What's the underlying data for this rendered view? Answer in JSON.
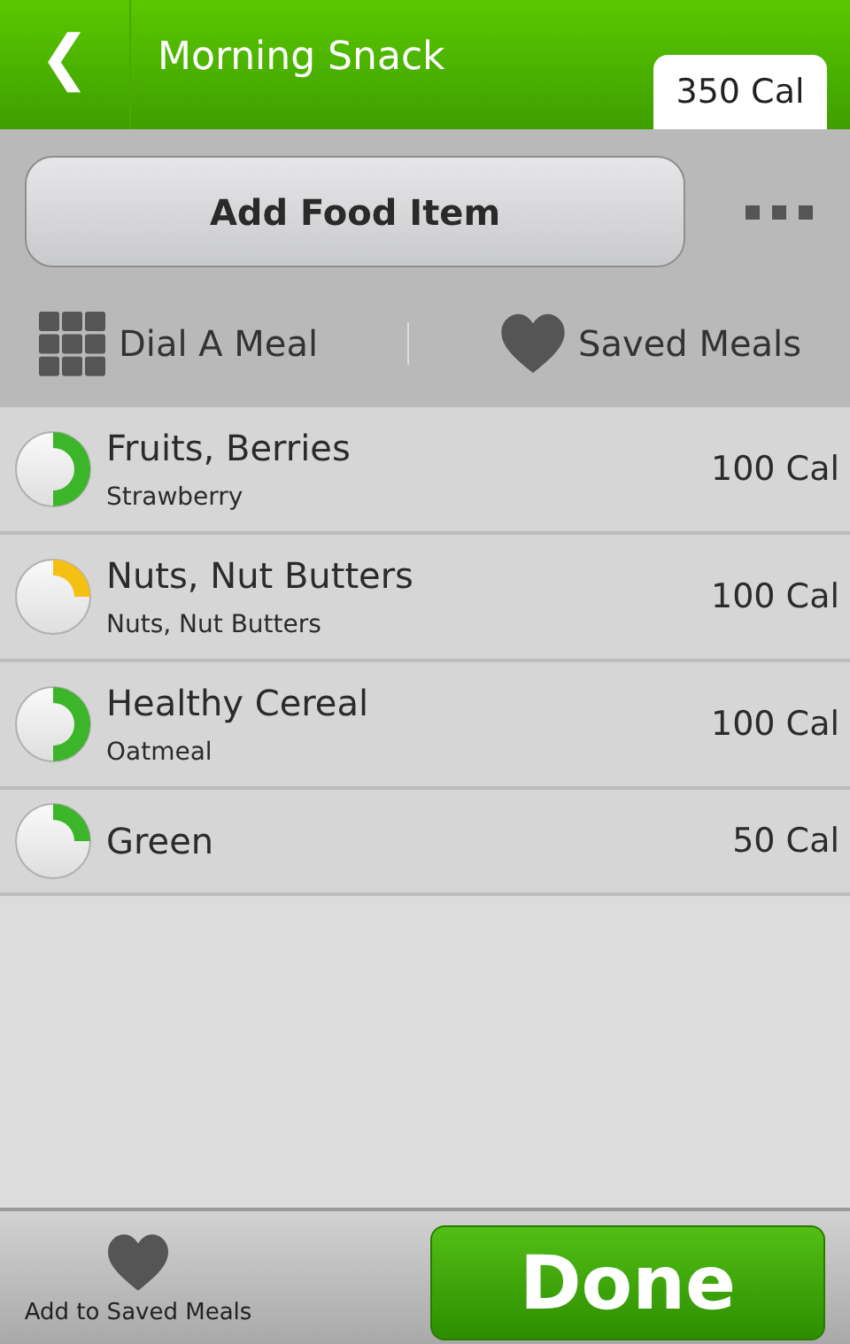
{
  "header": {
    "back": "❮",
    "title": "Morning Snack",
    "total": "350 Cal"
  },
  "actions": {
    "add_button": "Add Food Item",
    "dial": "Dial A Meal",
    "saved": "Saved Meals"
  },
  "foods": [
    {
      "name": "Fruits, Berries",
      "detail": "Strawberry",
      "calories": "100 Cal",
      "kind": "half",
      "color": "#3cb52a"
    },
    {
      "name": "Nuts, Nut Butters",
      "detail": "Nuts, Nut Butters",
      "calories": "100 Cal",
      "kind": "quarter",
      "color": "#f5c014"
    },
    {
      "name": "Healthy Cereal",
      "detail": "Oatmeal",
      "calories": "100 Cal",
      "kind": "half",
      "color": "#3cb52a"
    },
    {
      "name": "Green",
      "calories": "50 Cal",
      "kind": "quarter",
      "color": "#3cb52a"
    }
  ],
  "footer": {
    "add_saved": "Add to Saved Meals",
    "done": "Done"
  }
}
